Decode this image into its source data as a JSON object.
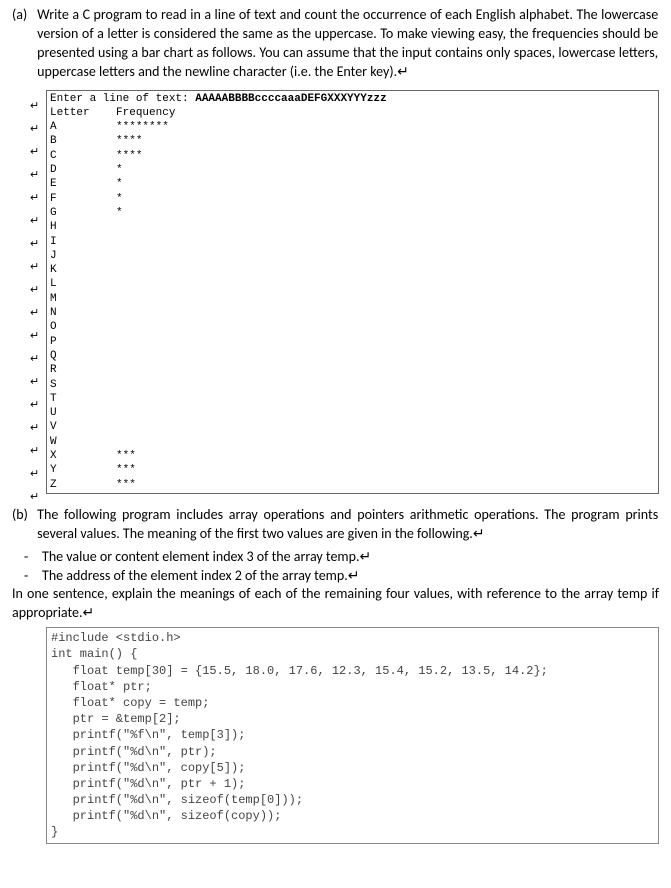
{
  "parta": {
    "label": "(a)",
    "text": "Write a C program to read in a line of text and count the occurrence of each English alphabet. The lowercase version of a letter is considered the same as the uppercase. To make viewing easy, the frequencies should be presented using a bar chart as follows. You can assume that the input contains only spaces, lowercase letters, uppercase letters and the newline character (i.e. the Enter key).↵"
  },
  "codebox_a": {
    "prompt": "Enter a line of text: ",
    "input": "AAAAABBBBccccaaaDEFGXXXYYYzzz",
    "header_letter": "Letter",
    "header_freq": "Frequency"
  },
  "chart_data": {
    "type": "bar",
    "title": "",
    "xlabel": "",
    "ylabel": "",
    "categories": [
      "A",
      "B",
      "C",
      "D",
      "E",
      "F",
      "G",
      "H",
      "I",
      "J",
      "K",
      "L",
      "M",
      "N",
      "O",
      "P",
      "Q",
      "R",
      "S",
      "T",
      "U",
      "V",
      "W",
      "X",
      "Y",
      "Z"
    ],
    "values": [
      8,
      4,
      4,
      1,
      1,
      1,
      1,
      0,
      0,
      0,
      0,
      0,
      0,
      0,
      0,
      0,
      0,
      0,
      0,
      0,
      0,
      0,
      0,
      3,
      3,
      3
    ]
  },
  "partb": {
    "label": "(b)",
    "text": "The following program includes array operations and pointers arithmetic operations. The program prints several values. The meaning of the first two values are given in the following.↵",
    "bullet1": "The value or content element index 3 of the array temp.↵",
    "bullet2": "The address of the element index 2 of the array temp.↵",
    "closing": "In one sentence, explain the meanings of each of the remaining four values, with reference to the array temp if appropriate.↵"
  },
  "codebox_b": {
    "l1": "#include <stdio.h>",
    "l2": "",
    "l3": "int main() {",
    "l4": "   float temp[30] = {15.5, 18.0, 17.6, 12.3, 15.4, 15.2, 13.5, 14.2};",
    "l5": "   float* ptr;",
    "l6": "   float* copy = temp;",
    "l7": "",
    "l8": "   ptr = &temp[2];",
    "l9": "",
    "l10": "   printf(\"%f\\n\", temp[3]);",
    "l11": "   printf(\"%d\\n\", ptr);",
    "l12": "   printf(\"%d\\n\", copy[5]);",
    "l13": "   printf(\"%d\\n\", ptr + 1);",
    "l14": "   printf(\"%d\\n\", sizeof(temp[0]));",
    "l15": "   printf(\"%d\\n\", sizeof(copy));",
    "l16": "}"
  }
}
